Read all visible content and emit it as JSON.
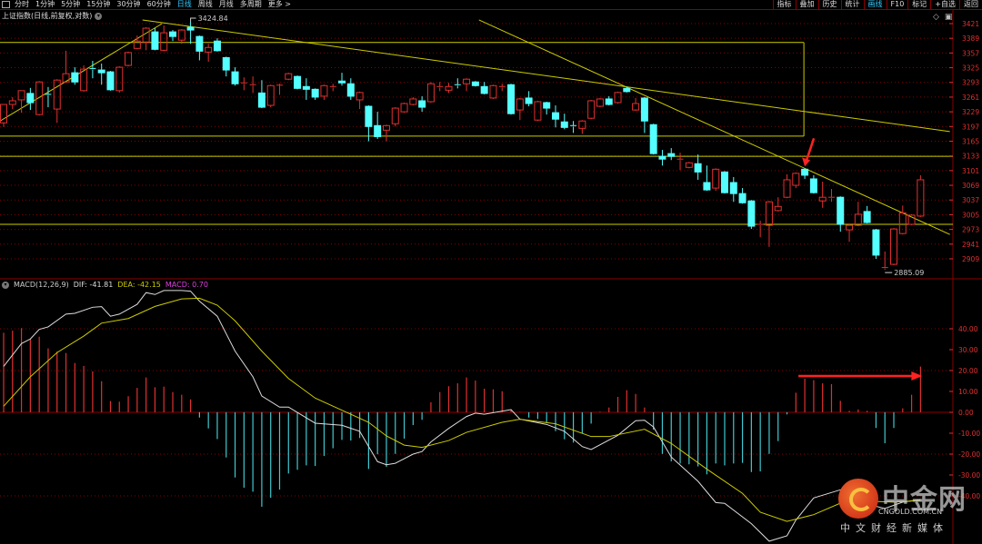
{
  "toolbar": {
    "periods": [
      "分时",
      "1分钟",
      "5分钟",
      "15分钟",
      "30分钟",
      "60分钟",
      "日线",
      "周线",
      "月线",
      "多周期",
      "更多 >"
    ],
    "active_period": "日线",
    "right_buttons": [
      "指标",
      "叠加",
      "历史",
      "统计",
      "画线",
      "F10",
      "标记",
      "+自选",
      "返回"
    ],
    "active_right": "画线"
  },
  "title": "上证指数(日线,前复权,对数)",
  "macd_label": {
    "name": "MACD(12,26,9)",
    "dif": "DIF: -41.81",
    "dea": "DEA: -42.15",
    "macd": "MACD: 0.70"
  },
  "colors": {
    "up": "#e03030",
    "down": "#54ffff",
    "dif": "#dddddd",
    "dea": "#cccc00",
    "macd": "#e040e0",
    "grid": "#8a0000",
    "axis": "#e03030",
    "annot": "#cccc00"
  },
  "watermark": {
    "brand": "中金网",
    "domain": "CNGOLD.COM.CN",
    "slogan": "中文财经新媒体"
  },
  "chart_data": [
    {
      "type": "candlestick",
      "title": "上证指数(日线,前复权,对数)",
      "yticks": [
        3421,
        3389,
        3357,
        3325,
        3293,
        3261,
        3229,
        3197,
        3165,
        3133,
        3101,
        3069,
        3037,
        3005,
        2973,
        2941,
        2909
      ],
      "ylim": [
        2880,
        3432
      ],
      "annotations": {
        "high": {
          "index": 21,
          "label": "3424.84"
        },
        "low": {
          "index": 99,
          "label": "2885.09"
        }
      },
      "hlines": [
        3380,
        3176,
        3132,
        2984
      ],
      "box": {
        "from_index": -0.4,
        "to_index": 89.9,
        "top": 3380,
        "bottom": 3176
      },
      "trendlines": [
        [
          [
            -0.4,
            3209
          ],
          [
            17.8,
            3421
          ]
        ],
        [
          [
            15.6,
            3429
          ],
          [
            106.3,
            3186
          ]
        ],
        [
          [
            53.4,
            3429
          ],
          [
            106.3,
            2962
          ]
        ]
      ],
      "arrow_index": 90,
      "ohlc": [
        [
          3205,
          3245,
          3196,
          3245
        ],
        [
          3245,
          3261,
          3235,
          3253
        ],
        [
          3255,
          3275,
          3227,
          3275
        ],
        [
          3269,
          3281,
          3233,
          3249
        ],
        [
          3223,
          3296,
          3221,
          3294
        ],
        [
          3267,
          3283,
          3239,
          3265
        ],
        [
          3235,
          3300,
          3205,
          3298
        ],
        [
          3294,
          3362,
          3292,
          3312
        ],
        [
          3314,
          3326,
          3288,
          3294
        ],
        [
          3275,
          3330,
          3273,
          3322
        ],
        [
          3323,
          3340,
          3302,
          3321
        ],
        [
          3320,
          3334,
          3288,
          3314
        ],
        [
          3316,
          3318,
          3275,
          3277
        ],
        [
          3275,
          3328,
          3271,
          3326
        ],
        [
          3330,
          3360,
          3328,
          3358
        ],
        [
          3367,
          3395,
          3365,
          3383
        ],
        [
          3381,
          3413,
          3363,
          3411
        ],
        [
          3403,
          3411,
          3363,
          3365
        ],
        [
          3363,
          3417,
          3361,
          3401
        ],
        [
          3403,
          3407,
          3383,
          3393
        ],
        [
          3385,
          3409,
          3377,
          3407
        ],
        [
          3413,
          3425,
          3377,
          3407
        ],
        [
          3393,
          3395,
          3341,
          3361
        ],
        [
          3359,
          3377,
          3338,
          3369
        ],
        [
          3383,
          3389,
          3360,
          3362
        ],
        [
          3347,
          3349,
          3306,
          3320
        ],
        [
          3316,
          3326,
          3286,
          3290
        ],
        [
          3290,
          3304,
          3276,
          3292
        ],
        [
          3286,
          3306,
          3270,
          3288
        ],
        [
          3270,
          3298,
          3237,
          3239
        ],
        [
          3243,
          3288,
          3239,
          3286
        ],
        [
          3286,
          3290,
          3266,
          3287
        ],
        [
          3300,
          3314,
          3298,
          3312
        ],
        [
          3306,
          3308,
          3278,
          3280
        ],
        [
          3284,
          3302,
          3255,
          3278
        ],
        [
          3278,
          3280,
          3255,
          3261
        ],
        [
          3263,
          3288,
          3255,
          3286
        ],
        [
          3282,
          3290,
          3274,
          3284
        ],
        [
          3296,
          3314,
          3286,
          3292
        ],
        [
          3290,
          3302,
          3255,
          3263
        ],
        [
          3255,
          3273,
          3235,
          3271
        ],
        [
          3241,
          3243,
          3165,
          3197
        ],
        [
          3199,
          3229,
          3170,
          3175
        ],
        [
          3189,
          3201,
          3165,
          3199
        ],
        [
          3203,
          3239,
          3197,
          3237
        ],
        [
          3229,
          3249,
          3227,
          3247
        ],
        [
          3245,
          3261,
          3243,
          3257
        ],
        [
          3253,
          3263,
          3229,
          3239
        ],
        [
          3251,
          3294,
          3249,
          3290
        ],
        [
          3282,
          3294,
          3274,
          3284
        ],
        [
          3276,
          3292,
          3270,
          3284
        ],
        [
          3288,
          3302,
          3280,
          3286
        ],
        [
          3290,
          3302,
          3274,
          3300
        ],
        [
          3294,
          3296,
          3284,
          3286
        ],
        [
          3284,
          3294,
          3267,
          3269
        ],
        [
          3259,
          3288,
          3257,
          3286
        ],
        [
          3282,
          3290,
          3274,
          3284
        ],
        [
          3288,
          3290,
          3223,
          3225
        ],
        [
          3233,
          3259,
          3211,
          3257
        ],
        [
          3259,
          3274,
          3241,
          3247
        ],
        [
          3211,
          3253,
          3209,
          3251
        ],
        [
          3249,
          3251,
          3223,
          3237
        ],
        [
          3227,
          3243,
          3195,
          3213
        ],
        [
          3207,
          3225,
          3191,
          3195
        ],
        [
          3199,
          3209,
          3183,
          3197
        ],
        [
          3193,
          3211,
          3181,
          3209
        ],
        [
          3215,
          3255,
          3213,
          3253
        ],
        [
          3241,
          3259,
          3239,
          3257
        ],
        [
          3257,
          3263,
          3243,
          3245
        ],
        [
          3249,
          3273,
          3247,
          3271
        ],
        [
          3280,
          3284,
          3271,
          3273
        ],
        [
          3233,
          3259,
          3231,
          3247
        ],
        [
          3259,
          3261,
          3183,
          3209
        ],
        [
          3201,
          3203,
          3136,
          3138
        ],
        [
          3132,
          3146,
          3112,
          3126
        ],
        [
          3138,
          3150,
          3124,
          3132
        ],
        [
          3124,
          3140,
          3102,
          3126
        ],
        [
          3108,
          3120,
          3106,
          3118
        ],
        [
          3116,
          3136,
          3081,
          3098
        ],
        [
          3075,
          3112,
          3057,
          3059
        ],
        [
          3063,
          3106,
          3057,
          3104
        ],
        [
          3098,
          3100,
          3051,
          3053
        ],
        [
          3075,
          3087,
          3033,
          3051
        ],
        [
          3051,
          3063,
          3029,
          3031
        ],
        [
          3035,
          3037,
          2974,
          2980
        ],
        [
          2982,
          2992,
          2956,
          2984
        ],
        [
          2982,
          3035,
          2935,
          3033
        ],
        [
          3014,
          3043,
          3012,
          3023
        ],
        [
          3043,
          3093,
          3041,
          3081
        ],
        [
          3069,
          3097,
          3063,
          3095
        ],
        [
          3104,
          3106,
          3083,
          3091
        ],
        [
          3083,
          3091,
          3051,
          3053
        ],
        [
          3035,
          3077,
          3020,
          3043
        ],
        [
          3041,
          3061,
          3033,
          3043
        ],
        [
          3043,
          3045,
          2968,
          2984
        ],
        [
          2972,
          2984,
          2946,
          2982
        ],
        [
          2982,
          3033,
          2980,
          3006
        ],
        [
          3012,
          3024,
          2986,
          2988
        ],
        [
          2972,
          2974,
          2909,
          2917
        ],
        [
          2888,
          2925,
          2885,
          2890
        ],
        [
          2897,
          2976,
          2895,
          2974
        ],
        [
          2964,
          3025,
          2962,
          3009
        ],
        [
          2984,
          3006,
          2982,
          3004
        ],
        [
          3002,
          3091,
          3000,
          3081
        ]
      ]
    },
    {
      "type": "bar",
      "title": "MACD(12,26,9)",
      "yticks": [
        40,
        30,
        20,
        10,
        0,
        -10,
        -20,
        -30,
        -40
      ],
      "ylim": [
        -64,
        62
      ],
      "macd": [
        38.1,
        39.1,
        40.3,
        35.2,
        36.2,
        30.6,
        29.1,
        28.4,
        23.6,
        22.2,
        19.6,
        14.9,
        5.4,
        5.1,
        7.7,
        11.7,
        16.7,
        12.0,
        12.3,
        9.7,
        8.4,
        6.2,
        -2.5,
        -7.7,
        -12.8,
        -21.6,
        -31.2,
        -36.1,
        -38.0,
        -45.2,
        -40.9,
        -37.0,
        -29.3,
        -27.5,
        -25.4,
        -25.7,
        -20.9,
        -17.2,
        -13.2,
        -13.5,
        -12.3,
        -27.1,
        -20.1,
        -26.1,
        -19.9,
        -12.6,
        -6.1,
        -3.6,
        4.8,
        9.7,
        12.5,
        13.9,
        16.7,
        15.2,
        11.3,
        11.0,
        10.1,
        1.2,
        0.2,
        -2.5,
        -3.2,
        -5.1,
        -9.0,
        -12.9,
        -14.5,
        -10.0,
        -5.4,
        0.3,
        2.3,
        7.4,
        10.6,
        8.8,
        2.3,
        -8.3,
        -19.9,
        -23.5,
        -24.5,
        -24.9,
        -25.9,
        -29.7,
        -24.5,
        -25.4,
        -24.5,
        -24.2,
        -28.6,
        -28.3,
        -19.9,
        -13.8,
        -1.0,
        9.4,
        16.1,
        15.4,
        13.9,
        13.5,
        5.5,
        0.7,
        1.4,
        0.7,
        -7.5,
        -14.8,
        -7.5,
        1.9,
        8.4,
        21.9
      ],
      "dif": [
        [
          0,
          22.0
        ],
        [
          2,
          32.9
        ],
        [
          3,
          35.1
        ],
        [
          4,
          39.7
        ],
        [
          5,
          40.9
        ],
        [
          7,
          47.0
        ],
        [
          8,
          47.4
        ],
        [
          10,
          50.3
        ],
        [
          11,
          50.6
        ],
        [
          12,
          46.0
        ],
        [
          13,
          47.0
        ],
        [
          15,
          51.7
        ],
        [
          16,
          57.3
        ],
        [
          17,
          56.4
        ],
        [
          18,
          58.3
        ],
        [
          20,
          58.3
        ],
        [
          21,
          58.0
        ],
        [
          22,
          53.2
        ],
        [
          24,
          46.0
        ],
        [
          26,
          29.3
        ],
        [
          28,
          17.0
        ],
        [
          29,
          7.8
        ],
        [
          31,
          2.5
        ],
        [
          32,
          2.5
        ],
        [
          35,
          -5.2
        ],
        [
          38,
          -6.2
        ],
        [
          40,
          -9.1
        ],
        [
          42,
          -23.6
        ],
        [
          43,
          -25.1
        ],
        [
          44,
          -24.4
        ],
        [
          46,
          -20.0
        ],
        [
          47,
          -18.8
        ],
        [
          48,
          -14.2
        ],
        [
          50,
          -7.7
        ],
        [
          52,
          -2.0
        ],
        [
          53,
          -0.4
        ],
        [
          54,
          -0.9
        ],
        [
          57,
          1.3
        ],
        [
          58,
          -3.3
        ],
        [
          61,
          -5.8
        ],
        [
          63,
          -9.1
        ],
        [
          65,
          -16.4
        ],
        [
          66,
          -17.8
        ],
        [
          69,
          -11.0
        ],
        [
          71,
          -4.0
        ],
        [
          72,
          -3.8
        ],
        [
          73,
          -7.0
        ],
        [
          75,
          -21.4
        ],
        [
          78,
          -33.0
        ],
        [
          80,
          -43.2
        ],
        [
          81,
          -43.6
        ],
        [
          84,
          -53.3
        ],
        [
          86,
          -61.7
        ],
        [
          88,
          -59.1
        ],
        [
          89,
          -51.6
        ],
        [
          91,
          -41.0
        ],
        [
          94,
          -37.1
        ],
        [
          95,
          -38.0
        ],
        [
          97,
          -44.0
        ],
        [
          99,
          -46.0
        ],
        [
          101,
          -43.0
        ],
        [
          103,
          -41.8
        ]
      ],
      "dea": [
        [
          0,
          2.9
        ],
        [
          3,
          17.0
        ],
        [
          6,
          28.6
        ],
        [
          9,
          36.5
        ],
        [
          11,
          42.7
        ],
        [
          14,
          44.9
        ],
        [
          17,
          50.7
        ],
        [
          20,
          54.3
        ],
        [
          22,
          54.6
        ],
        [
          24,
          51.3
        ],
        [
          26,
          43.8
        ],
        [
          29,
          29.3
        ],
        [
          32,
          16.2
        ],
        [
          35,
          6.8
        ],
        [
          38,
          1.0
        ],
        [
          41,
          -4.8
        ],
        [
          43,
          -11.3
        ],
        [
          45,
          -15.7
        ],
        [
          47,
          -16.8
        ],
        [
          50,
          -13.5
        ],
        [
          52,
          -9.6
        ],
        [
          56,
          -4.8
        ],
        [
          58,
          -3.3
        ],
        [
          62,
          -5.5
        ],
        [
          66,
          -11.6
        ],
        [
          68,
          -11.6
        ],
        [
          72,
          -8.1
        ],
        [
          75,
          -14.9
        ],
        [
          79,
          -27.2
        ],
        [
          83,
          -38.8
        ],
        [
          85,
          -47.8
        ],
        [
          88,
          -52.2
        ],
        [
          91,
          -49.0
        ],
        [
          94,
          -43.5
        ],
        [
          97,
          -42.5
        ],
        [
          100,
          -43.0
        ],
        [
          103,
          -42.15
        ]
      ],
      "arrow_from_index": 90,
      "arrow_to_index": 103
    }
  ]
}
